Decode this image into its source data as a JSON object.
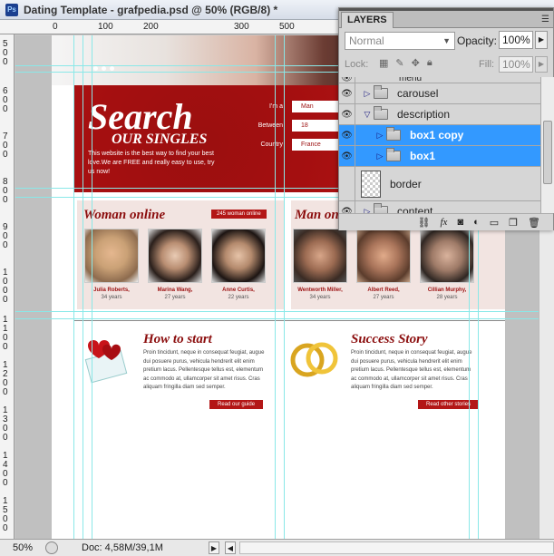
{
  "window": {
    "title": "Dating Template - grafpedia.psd @ 50% (RGB/8) *",
    "app_icon": "Ps"
  },
  "rulers": {
    "top": [
      "0",
      "100",
      "200",
      "300",
      "500"
    ],
    "left": [
      "500",
      "600",
      "700",
      "800",
      "900",
      "1000",
      "1100",
      "1200",
      "1300",
      "1400",
      "1500"
    ]
  },
  "canvas": {
    "search": {
      "title": "Search",
      "subtitle": "OUR SINGLES",
      "description": "This website is the best way to find your best love.We are FREE and really easy to use, try us now!",
      "form": [
        {
          "label": "I'm a",
          "value": "Man"
        },
        {
          "label": "Between",
          "value": "18"
        },
        {
          "label": "Country",
          "value": "France"
        }
      ]
    },
    "woman_online": {
      "title": "Woman online",
      "badge": "245 woman online",
      "people": [
        {
          "name": "Julia Roberts,",
          "age": "34 years"
        },
        {
          "name": "Marina Wang,",
          "age": "27 years"
        },
        {
          "name": "Anne Curtis,",
          "age": "22 years"
        }
      ]
    },
    "man_online": {
      "title": "Man on",
      "people": [
        {
          "name": "Wentworth Miller,",
          "age": "34 years"
        },
        {
          "name": "Albert Reed,",
          "age": "27 years"
        },
        {
          "name": "Cillian Murphy,",
          "age": "28 years"
        }
      ]
    },
    "how_to_start": {
      "title": "How to start",
      "text": "Proin tincidunt, neque in consequat feugiat, augue dui posuere purus, vehicula hendrerit elit enim pretium lacus. Pellentesque tellus est, elementum ac commodo at, ullamcorper sit amet risus. Cras aliquam fringilla diam sed semper.",
      "button": "Read our guide"
    },
    "success_story": {
      "title": "Success Story",
      "text": "Proin tincidunt, neque in consequat feugiat, augue dui posuere purus, vehicula hendrerit elit enim pretium lacus. Pellentesque tellus est, elementum ac commodo at, ullamcorper sit amet risus. Cras aliquam fringilla diam sed semper.",
      "button": "Read other stories"
    }
  },
  "layers_panel": {
    "tab": "LAYERS",
    "blend_mode": "Normal",
    "opacity_label": "Opacity:",
    "opacity": "100%",
    "lock_label": "Lock:",
    "fill_label": "Fill:",
    "fill": "100%",
    "partial_top_row": "menu",
    "layers": [
      {
        "name": "carousel",
        "type": "folder",
        "expanded": false,
        "selected": false,
        "indent": 0
      },
      {
        "name": "description",
        "type": "folder",
        "expanded": true,
        "selected": false,
        "indent": 0
      },
      {
        "name": "box1 copy",
        "type": "folder",
        "expanded": false,
        "selected": true,
        "indent": 1
      },
      {
        "name": "box1",
        "type": "folder",
        "expanded": false,
        "selected": true,
        "indent": 1
      },
      {
        "name": "border",
        "type": "layer",
        "expanded": false,
        "selected": false,
        "indent": 0
      },
      {
        "name": "content",
        "type": "folder",
        "expanded": false,
        "selected": false,
        "indent": 0
      }
    ]
  },
  "statusbar": {
    "zoom": "50%",
    "doc_info": "Doc: 4,58M/39,1M"
  },
  "colors": {
    "accent_red": "#b31616",
    "selection_blue": "#3399ff",
    "guide_cyan": "#8ae8e8"
  }
}
